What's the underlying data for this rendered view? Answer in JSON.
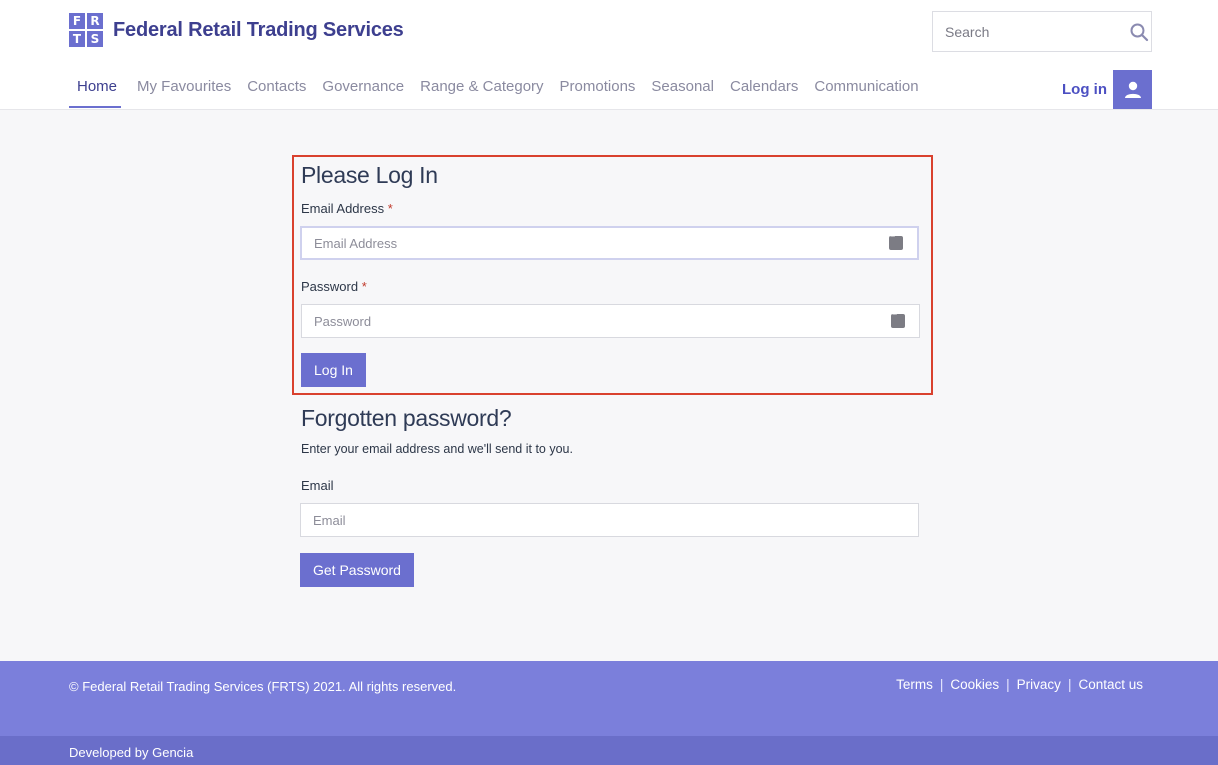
{
  "header": {
    "logo_letters": [
      "F",
      "R",
      "T",
      "S"
    ],
    "site_name": "Federal Retail Trading Services",
    "search_placeholder": "Search",
    "login_label": "Log in",
    "nav": [
      "Home",
      "My Favourites",
      "Contacts",
      "Governance",
      "Range & Category",
      "Promotions",
      "Seasonal",
      "Calendars",
      "Communication"
    ]
  },
  "login_form": {
    "title": "Please Log In",
    "email_label": "Email Address",
    "email_placeholder": "Email Address",
    "password_label": "Password",
    "password_placeholder": "Password",
    "required_mark": "*",
    "submit_label": "Log In"
  },
  "forgot": {
    "title": "Forgotten password?",
    "description": "Enter your email address and we'll send it to you.",
    "email_label": "Email",
    "email_placeholder": "Email",
    "submit_label": "Get Password"
  },
  "footer": {
    "copyright": "© Federal Retail Trading Services (FRTS) 2021. All rights reserved.",
    "links": [
      "Terms",
      "Cookies",
      "Privacy",
      "Contact us"
    ],
    "developer": "Developed by Gencia"
  },
  "colors": {
    "brand": "#6b6fcf",
    "brand_dark": "#3d3f8f",
    "highlight_border": "#d9412e",
    "footer_bg": "#7b7fdb",
    "subfooter_bg": "#6a6ec9"
  }
}
